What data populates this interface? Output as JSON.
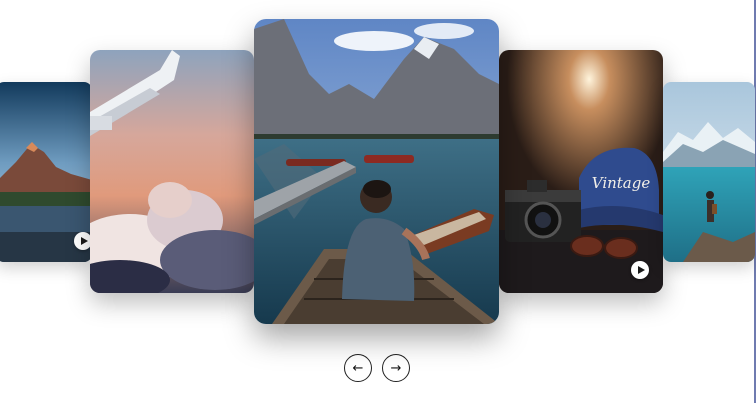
{
  "carousel": {
    "cards": [
      {
        "id": "mountain-lake-sunset",
        "has_video": true
      },
      {
        "id": "airplane-wing-clouds",
        "has_video": false
      },
      {
        "id": "man-on-dock-lake",
        "has_video": false,
        "active": true
      },
      {
        "id": "camera-vintage-cap",
        "has_video": true,
        "cap_text": "Vintage"
      },
      {
        "id": "hiker-glacier-lake",
        "has_video": false
      }
    ]
  },
  "controls": {
    "prev_icon": "←",
    "next_icon": "→"
  },
  "icons": {
    "play": "play-icon",
    "prev": "arrow-left-icon",
    "next": "arrow-right-icon"
  },
  "colors": {
    "frame_edge": "#6f7bb0",
    "nav_border": "#222222",
    "background": "#ffffff"
  }
}
